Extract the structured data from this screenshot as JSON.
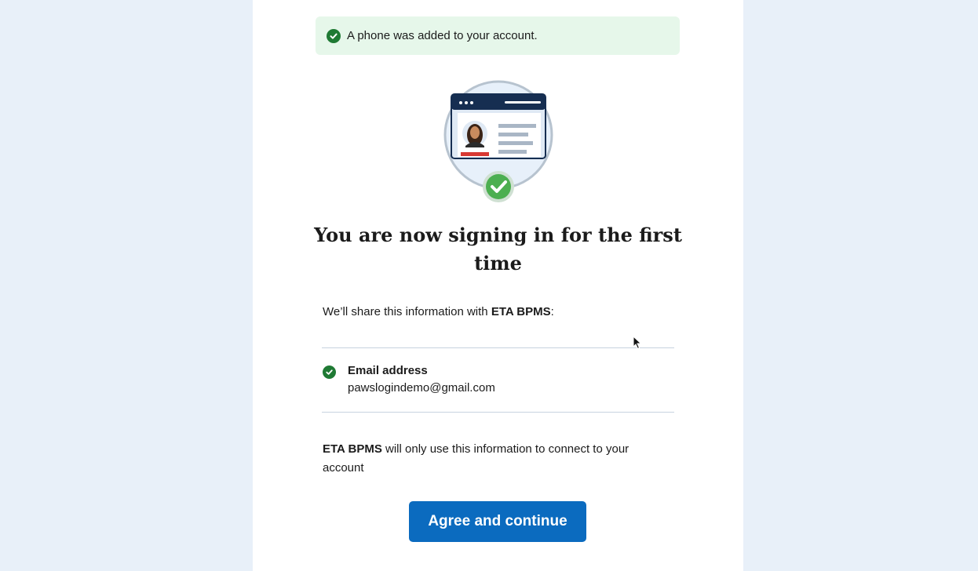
{
  "alert": {
    "icon": "check-circle-icon",
    "text": "A phone was added to your account."
  },
  "hero": {
    "icon": "id-card-verified-illustration"
  },
  "heading": "You are now signing in for the first time",
  "share": {
    "prefix": "We’ll share this information with ",
    "partner": "ETA BPMS",
    "suffix": ":"
  },
  "attributes": [
    {
      "icon": "check-circle-icon",
      "label": "Email address",
      "value": "pawslogindemo@gmail.com"
    }
  ],
  "note": {
    "partner": "ETA BPMS",
    "text": " will only use this information to connect to your account"
  },
  "button": {
    "label": "Agree and continue"
  },
  "colors": {
    "page_bg": "#e8f0f9",
    "alert_bg": "#e6f7ea",
    "success": "#1f7a34",
    "primary": "#0b6bbf"
  }
}
